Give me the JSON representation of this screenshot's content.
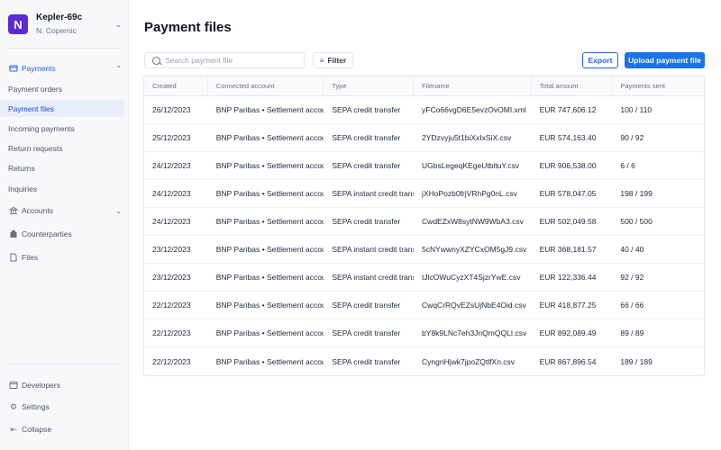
{
  "org": {
    "logo_letter": "N",
    "name": "Kepler-69c",
    "user": "N. Copernic"
  },
  "sidebar": {
    "payments": {
      "label": "Payments",
      "icon": "payments-icon"
    },
    "payment_items": [
      "Payment orders",
      "Payment files",
      "Incoming payments",
      "Return requests",
      "Returns",
      "Inquiries"
    ],
    "accounts": {
      "label": "Accounts",
      "icon": "bank-icon"
    },
    "counterparties": {
      "label": "Counterparties",
      "icon": "building-icon"
    },
    "files": {
      "label": "Files",
      "icon": "file-icon"
    },
    "developers": {
      "label": "Developers",
      "icon": "code-icon"
    },
    "settings": {
      "label": "Settings",
      "icon": "gear-icon"
    },
    "collapse": {
      "label": "Collapse",
      "icon": "collapse-icon"
    }
  },
  "page": {
    "title": "Payment files",
    "search_placeholder": "Search payment file",
    "filter_label": "Filter",
    "export_label": "Export",
    "upload_label": "Upload payment file"
  },
  "table": {
    "columns": [
      "Created",
      "Connected account",
      "Type",
      "Filename",
      "Total amount",
      "Payments sent"
    ],
    "rows": [
      [
        "26/12/2023",
        "BNP Paribas • Settlement account",
        "SEPA credit transfer",
        "yFCo66vgD6E5evzOvOMI.xml",
        "EUR 747,606.12",
        "100 / 110"
      ],
      [
        "25/12/2023",
        "BNP Paribas • Settlement account",
        "SEPA credit transfer",
        "2YDzvyju5t1biXxIxSiX.csv",
        "EUR 574,163.40",
        "90 / 92"
      ],
      [
        "24/12/2023",
        "BNP Paribas • Settlement account",
        "SEPA credit transfer",
        "UGbsLegeqKEgeUtbltuY.csv",
        "EUR 906,538.00",
        "6 / 6"
      ],
      [
        "24/12/2023",
        "BNP Paribas • Settlement account",
        "SEPA instant credit transfer",
        "jXHoPozb0frjVRhPg0nL.csv",
        "EUR 578,047.05",
        "198 / 199"
      ],
      [
        "24/12/2023",
        "BNP Paribas • Settlement account",
        "SEPA credit transfer",
        "CwdEZxW8sytNW9WbA3.csv",
        "EUR 502,049.58",
        "500 / 500"
      ],
      [
        "23/12/2023",
        "BNP Paribas • Settlement account",
        "SEPA instant credit transfer",
        "5cNYwwnyXZYCxOM5gJ9.csv",
        "EUR 368,181.57",
        "40 / 40"
      ],
      [
        "23/12/2023",
        "BNP Paribas • Settlement account",
        "SEPA instant credit transfer",
        "tJlcOWuCyzXT4SjzrYwE.csv",
        "EUR 122,336.44",
        "92 / 92"
      ],
      [
        "22/12/2023",
        "BNP Paribas • Settlement account",
        "SEPA credit transfer",
        "CwqCrRQvEZsUjNbE4Oid.csv",
        "EUR 418,877.25",
        "66 / 66"
      ],
      [
        "22/12/2023",
        "BNP Paribas • Settlement account",
        "SEPA credit transfer",
        "bY8k9LNc7eh3JnQmQQLI.csv",
        "EUR 892,089.49",
        "89 / 89"
      ],
      [
        "22/12/2023",
        "BNP Paribas • Settlement account",
        "SEPA credit transfer",
        "CyngnHjwk7jpoZQtlfXn.csv",
        "EUR 867,896.54",
        "189 / 189"
      ]
    ]
  },
  "colors": {
    "accent": "#1a73e8",
    "logo": "#5b2bd6",
    "active_bg": "#e8eefc"
  }
}
